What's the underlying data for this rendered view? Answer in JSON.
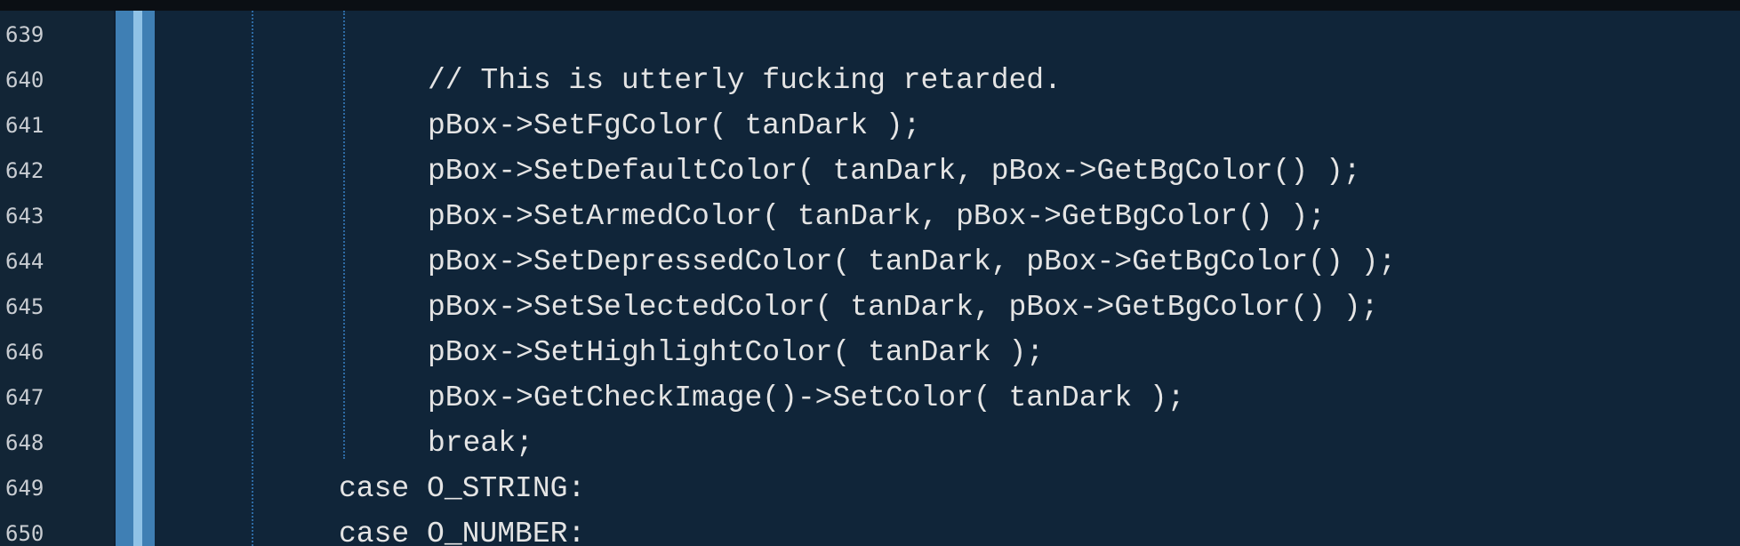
{
  "editor": {
    "lines": [
      {
        "number": "639",
        "code": ""
      },
      {
        "number": "640",
        "code": "// This is utterly fucking retarded."
      },
      {
        "number": "641",
        "code": "pBox->SetFgColor( tanDark );"
      },
      {
        "number": "642",
        "code": "pBox->SetDefaultColor( tanDark, pBox->GetBgColor() );"
      },
      {
        "number": "643",
        "code": "pBox->SetArmedColor( tanDark, pBox->GetBgColor() );"
      },
      {
        "number": "644",
        "code": "pBox->SetDepressedColor( tanDark, pBox->GetBgColor() );"
      },
      {
        "number": "645",
        "code": "pBox->SetSelectedColor( tanDark, pBox->GetBgColor() );"
      },
      {
        "number": "646",
        "code": "pBox->SetHighlightColor( tanDark );"
      },
      {
        "number": "647",
        "code": "pBox->GetCheckImage()->SetColor( tanDark );"
      },
      {
        "number": "648",
        "code": "break;"
      },
      {
        "number": "649",
        "code": "case O_STRING:"
      },
      {
        "number": "650",
        "code": "case O_NUMBER:"
      }
    ]
  },
  "colors": {
    "background": "#102539",
    "gutter": "#122536",
    "change_bar": "#3f7fb4",
    "indent_guide": "#2d6aa3",
    "code_text": "#e4e4e4",
    "line_number_text": "#c9cdd2"
  }
}
